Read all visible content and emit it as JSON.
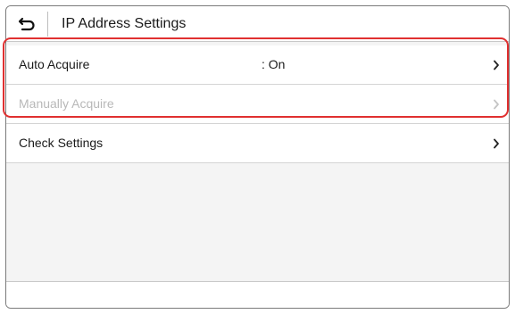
{
  "header": {
    "title": "IP Address Settings",
    "back_icon": "back-arrow-icon"
  },
  "menu": {
    "items": [
      {
        "label": "Auto Acquire",
        "value": ": On",
        "enabled": true,
        "icon": "chevron-right-icon"
      },
      {
        "label": "Manually Acquire",
        "value": "",
        "enabled": false,
        "icon": "chevron-right-icon"
      },
      {
        "label": "Check Settings",
        "value": "",
        "enabled": true,
        "icon": "chevron-right-icon"
      }
    ]
  },
  "colors": {
    "highlight": "#e03030",
    "disabled_text": "#b8b8b8",
    "background": "#f4f4f4"
  }
}
